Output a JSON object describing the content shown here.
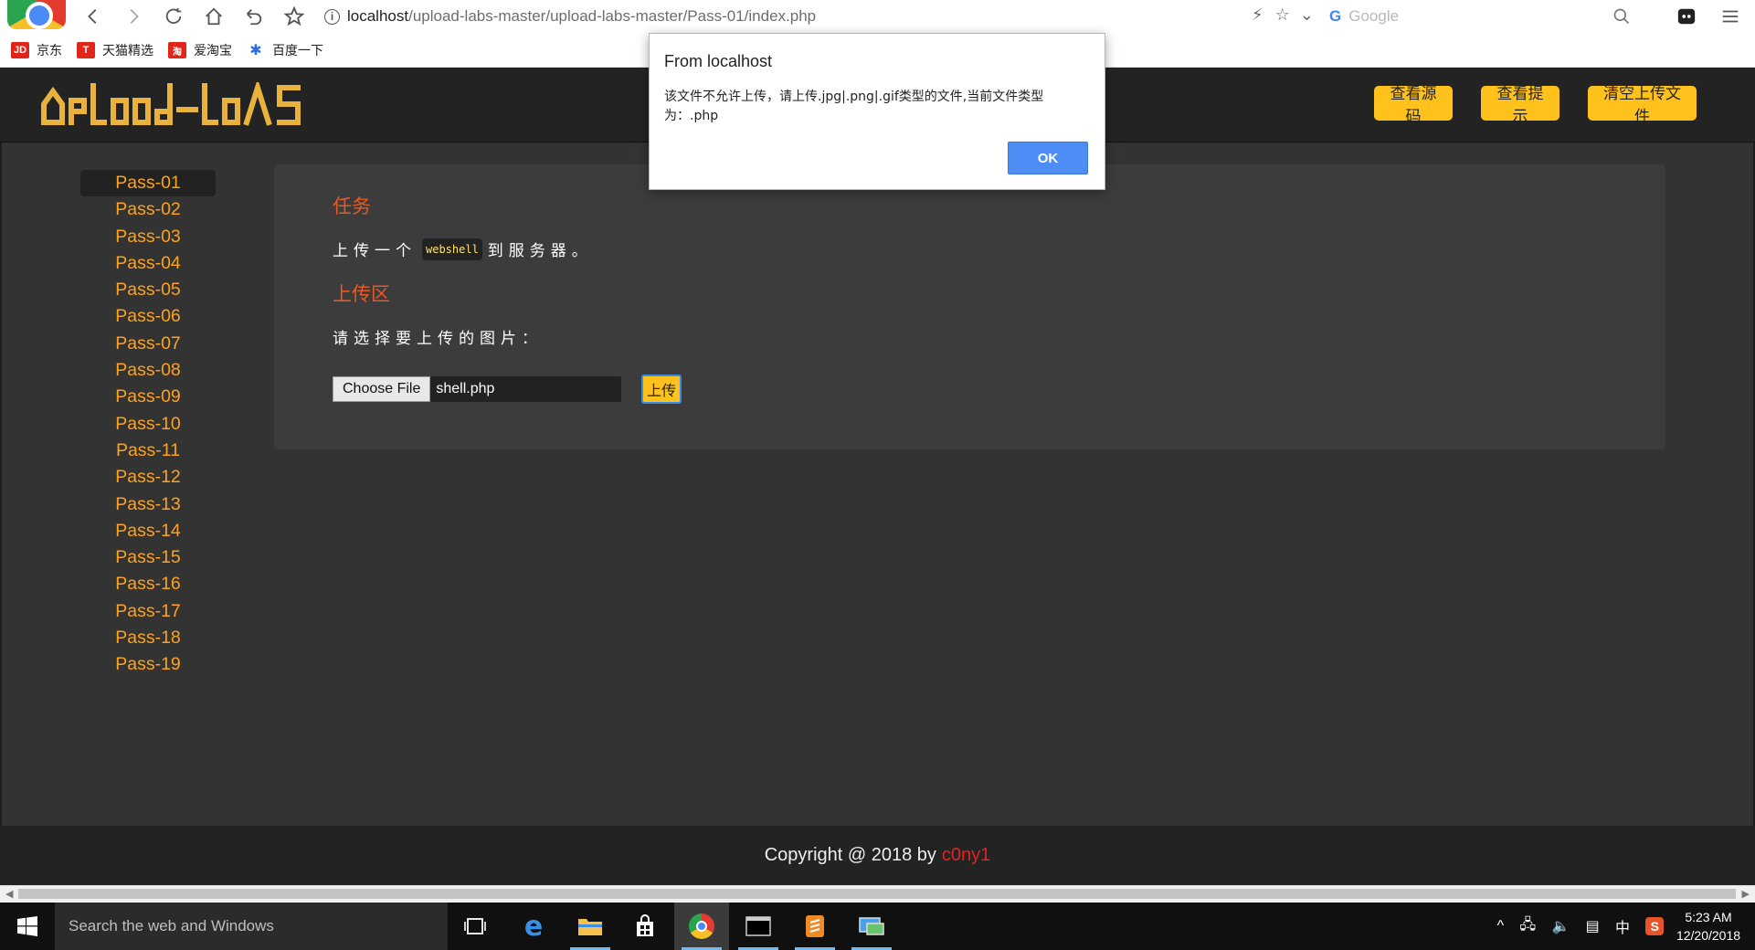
{
  "browser": {
    "url_host": "localhost",
    "url_path": "/upload-labs-master/upload-labs-master/Pass-01/index.php",
    "search_placeholder": "Google",
    "bookmarks": [
      {
        "label": "京东",
        "icon": "JD",
        "color": "#e1251b"
      },
      {
        "label": "天猫精选",
        "icon": "T",
        "color": "#e1251b"
      },
      {
        "label": "爱淘宝",
        "icon": "淘",
        "color": "#e1251b"
      },
      {
        "label": "百度一下",
        "icon": "paw-icon",
        "color": "#2b6be6"
      }
    ]
  },
  "header": {
    "logo_text": "UpLoad-labs",
    "buttons": [
      "查看源码",
      "查看提示",
      "清空上传文件"
    ]
  },
  "sidebar": {
    "items": [
      "Pass-01",
      "Pass-02",
      "Pass-03",
      "Pass-04",
      "Pass-05",
      "Pass-06",
      "Pass-07",
      "Pass-08",
      "Pass-09",
      "Pass-10",
      "Pass-11",
      "Pass-12",
      "Pass-13",
      "Pass-14",
      "Pass-15",
      "Pass-16",
      "Pass-17",
      "Pass-18",
      "Pass-19"
    ],
    "active": "Pass-01"
  },
  "main": {
    "task_title": "任务",
    "task_text_before": "上传一个",
    "task_code": "webshell",
    "task_text_after": "到服务器。",
    "upload_title": "上传区",
    "select_prompt": "请选择要上传的图片：",
    "choose_file_label": "Choose File",
    "file_name": "shell.php",
    "upload_button": "上传"
  },
  "footer": {
    "text": "Copyright @ 2018 by",
    "author": "c0ny1"
  },
  "alert": {
    "title": "From localhost",
    "message": "该文件不允许上传，请上传.jpg|.png|.gif类型的文件,当前文件类型为：.php",
    "ok": "OK"
  },
  "taskbar": {
    "search_placeholder": "Search the web and Windows",
    "time": "5:23 AM",
    "date": "12/20/2018",
    "ime": "中"
  },
  "colors": {
    "accent_yellow": "#ffc21d",
    "pass_link": "#ffa31a",
    "section_title": "#e85a24",
    "author": "#e02424"
  }
}
